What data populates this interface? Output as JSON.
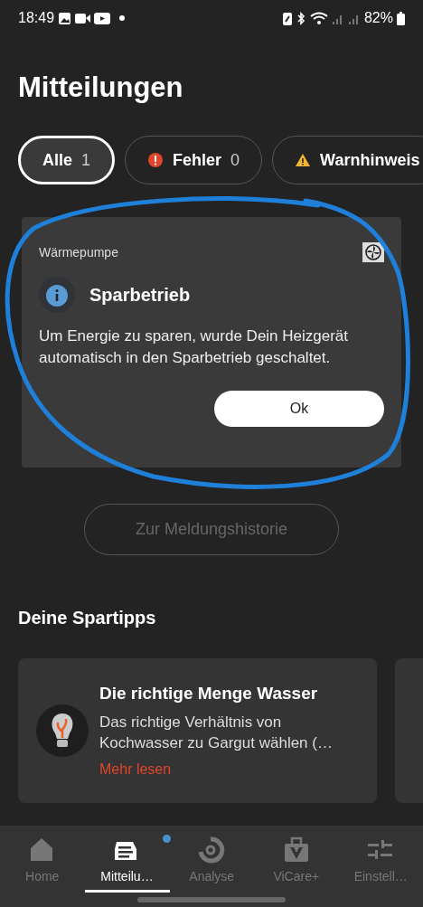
{
  "status_bar": {
    "time": "18:49",
    "battery": "82%"
  },
  "title": "Mitteilungen",
  "filters": [
    {
      "label": "Alle",
      "count": "1",
      "selected": true
    },
    {
      "label": "Fehler",
      "count": "0",
      "selected": false
    },
    {
      "label": "Warnhinweis",
      "selected": false
    }
  ],
  "notification": {
    "category": "Wärmepumpe",
    "title": "Sparbetrieb",
    "message": "Um Energie zu sparen, wurde Dein Heizgerät automatisch in den Sparbetrieb geschaltet.",
    "button": "Ok"
  },
  "annotation": {
    "kind": "circle"
  },
  "history_button": {
    "label": "Zur Meldungshistorie",
    "disabled": true
  },
  "section_title": "Deine Spartipps",
  "tips": [
    {
      "kind": "card",
      "title": "Die richtige Menge Wasser",
      "text": "Das richtige Verhältnis von Kochwasser zu Gargut wählen (…",
      "link": "Mehr lesen"
    },
    {
      "kind": "cut"
    }
  ],
  "nav": [
    {
      "label": "Home",
      "selected": false,
      "badge": false
    },
    {
      "label": "Mitteilu…",
      "selected": true,
      "badge": true
    },
    {
      "label": "Analyse",
      "selected": false,
      "badge": false
    },
    {
      "label": "ViCare+",
      "selected": false,
      "badge": false
    },
    {
      "label": "Einstell…",
      "selected": false,
      "badge": false
    }
  ]
}
